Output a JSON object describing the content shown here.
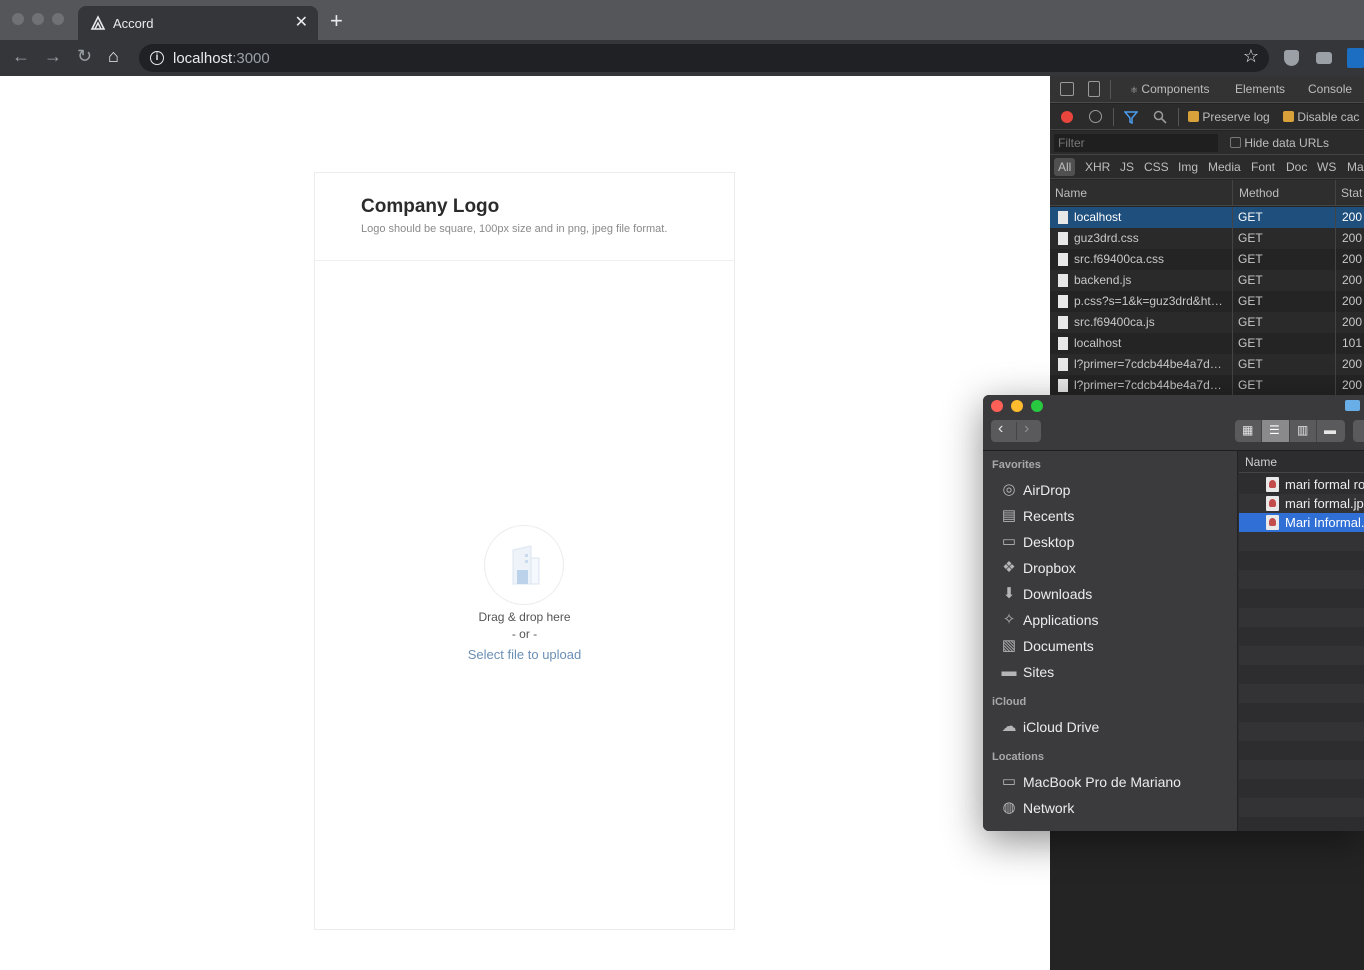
{
  "browser": {
    "tab_title": "Accord",
    "url_host": "localhost",
    "url_port": ":3000"
  },
  "page": {
    "card_title": "Company Logo",
    "card_subtitle": "Logo should be square, 100px size and in png, jpeg file format.",
    "drag_text": "Drag & drop here",
    "or_text": "- or -",
    "select_link": "Select file to upload"
  },
  "devtools": {
    "tabs": [
      "Components",
      "Elements",
      "Console"
    ],
    "preserve_log": "Preserve log",
    "disable_cache": "Disable cac",
    "filter_placeholder": "Filter",
    "hide_data_urls": "Hide data URLs",
    "types": [
      "All",
      "XHR",
      "JS",
      "CSS",
      "Img",
      "Media",
      "Font",
      "Doc",
      "WS",
      "Ma"
    ],
    "columns": [
      "Name",
      "Method",
      "Stat"
    ],
    "requests": [
      {
        "name": "localhost",
        "method": "GET",
        "status": "200"
      },
      {
        "name": "guz3drd.css",
        "method": "GET",
        "status": "200"
      },
      {
        "name": "src.f69400ca.css",
        "method": "GET",
        "status": "200"
      },
      {
        "name": "backend.js",
        "method": "GET",
        "status": "200"
      },
      {
        "name": "p.css?s=1&k=guz3drd&ht…",
        "method": "GET",
        "status": "200"
      },
      {
        "name": "src.f69400ca.js",
        "method": "GET",
        "status": "200"
      },
      {
        "name": "localhost",
        "method": "GET",
        "status": "101"
      },
      {
        "name": "l?primer=7cdcb44be4a7d…",
        "method": "GET",
        "status": "200"
      },
      {
        "name": "l?primer=7cdcb44be4a7d…",
        "method": "GET",
        "status": "200"
      }
    ]
  },
  "finder": {
    "sections": {
      "favorites": "Favorites",
      "icloud": "iCloud",
      "locations": "Locations"
    },
    "favorites": [
      "AirDrop",
      "Recents",
      "Desktop",
      "Dropbox",
      "Downloads",
      "Applications",
      "Documents",
      "Sites"
    ],
    "icloud_items": [
      "iCloud Drive"
    ],
    "locations": [
      "MacBook Pro de Mariano",
      "Network"
    ],
    "list_header": "Name",
    "files": [
      "mari formal ro",
      "mari formal.jp",
      "Mari Informal.j"
    ]
  },
  "colors": {
    "selected_row": "#1e4f7d",
    "finder_selection": "#2f6fd6",
    "link": "#6b8fb5"
  }
}
